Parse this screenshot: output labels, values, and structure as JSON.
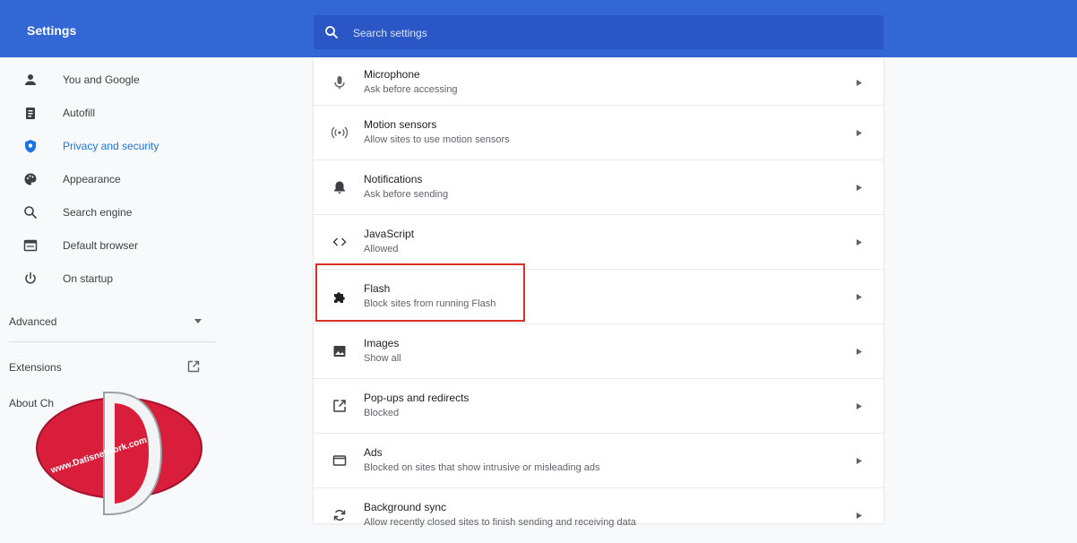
{
  "header": {
    "title": "Settings",
    "search_placeholder": "Search settings"
  },
  "sidebar": {
    "items": [
      {
        "label": "You and Google",
        "icon": "person-icon"
      },
      {
        "label": "Autofill",
        "icon": "clipboard-icon"
      },
      {
        "label": "Privacy and security",
        "icon": "shield-icon",
        "active": true
      },
      {
        "label": "Appearance",
        "icon": "palette-icon"
      },
      {
        "label": "Search engine",
        "icon": "search-icon"
      },
      {
        "label": "Default browser",
        "icon": "browser-icon"
      },
      {
        "label": "On startup",
        "icon": "power-icon"
      }
    ],
    "advanced_label": "Advanced",
    "extensions_label": "Extensions",
    "about_label": "About Ch"
  },
  "content": {
    "rows": [
      {
        "title": "Microphone",
        "subtitle": "Ask before accessing",
        "icon": "microphone-icon"
      },
      {
        "title": "Motion sensors",
        "subtitle": "Allow sites to use motion sensors",
        "icon": "motion-sensor-icon"
      },
      {
        "title": "Notifications",
        "subtitle": "Ask before sending",
        "icon": "bell-icon"
      },
      {
        "title": "JavaScript",
        "subtitle": "Allowed",
        "icon": "code-icon"
      },
      {
        "title": "Flash",
        "subtitle": "Block sites from running Flash",
        "icon": "puzzle-icon",
        "highlighted": true
      },
      {
        "title": "Images",
        "subtitle": "Show all",
        "icon": "image-icon"
      },
      {
        "title": "Pop-ups and redirects",
        "subtitle": "Blocked",
        "icon": "open-external-icon"
      },
      {
        "title": "Ads",
        "subtitle": "Blocked on sites that show intrusive or misleading ads",
        "icon": "ads-icon"
      },
      {
        "title": "Background sync",
        "subtitle": "Allow recently closed sites to finish sending and receiving data",
        "icon": "sync-icon"
      }
    ]
  },
  "watermark": {
    "text": "www.Datisnetwork.com",
    "letter": "D"
  },
  "colors": {
    "header_bg": "#3367d6",
    "search_bg": "#2a56c6",
    "accent": "#1a73e8",
    "highlight_border": "#d93025",
    "logo_red": "#d81e3a"
  }
}
